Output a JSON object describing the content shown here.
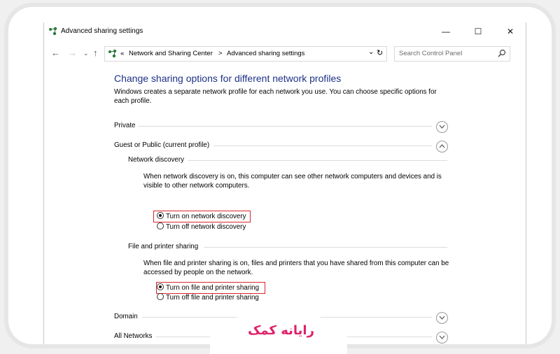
{
  "window": {
    "title": "Advanced sharing settings",
    "controls": {
      "minimize": "—",
      "maximize": "☐",
      "close": "✕"
    }
  },
  "address_bar": {
    "breadcrumb_sep": "«",
    "items": [
      "Network and Sharing Center",
      "Advanced sharing settings"
    ],
    "separator": ">"
  },
  "search": {
    "placeholder": "Search Control Panel"
  },
  "main": {
    "heading": "Change sharing options for different network profiles",
    "description": "Windows creates a separate network profile for each network you use. You can choose specific options for each profile.",
    "profiles": {
      "private": "Private",
      "guest_public": "Guest or Public (current profile)",
      "domain": "Domain",
      "all_networks": "All Networks"
    },
    "network_discovery": {
      "title": "Network discovery",
      "text": "When network discovery is on, this computer can see other network computers and devices and is visible to other network computers.",
      "on": "Turn on network discovery",
      "off": "Turn off network discovery",
      "selected": "on"
    },
    "file_printer_sharing": {
      "title": "File and printer sharing",
      "text": "When file and printer sharing is on, files and printers that you have shared from this computer can be accessed by people on the network.",
      "on": "Turn on file and printer sharing",
      "off": "Turn off file and printer sharing",
      "selected": "on"
    }
  },
  "watermark": "رایانه کمک",
  "colors": {
    "heading": "#1e3287",
    "highlight": "#d9262b",
    "brand": "#e0206a"
  }
}
